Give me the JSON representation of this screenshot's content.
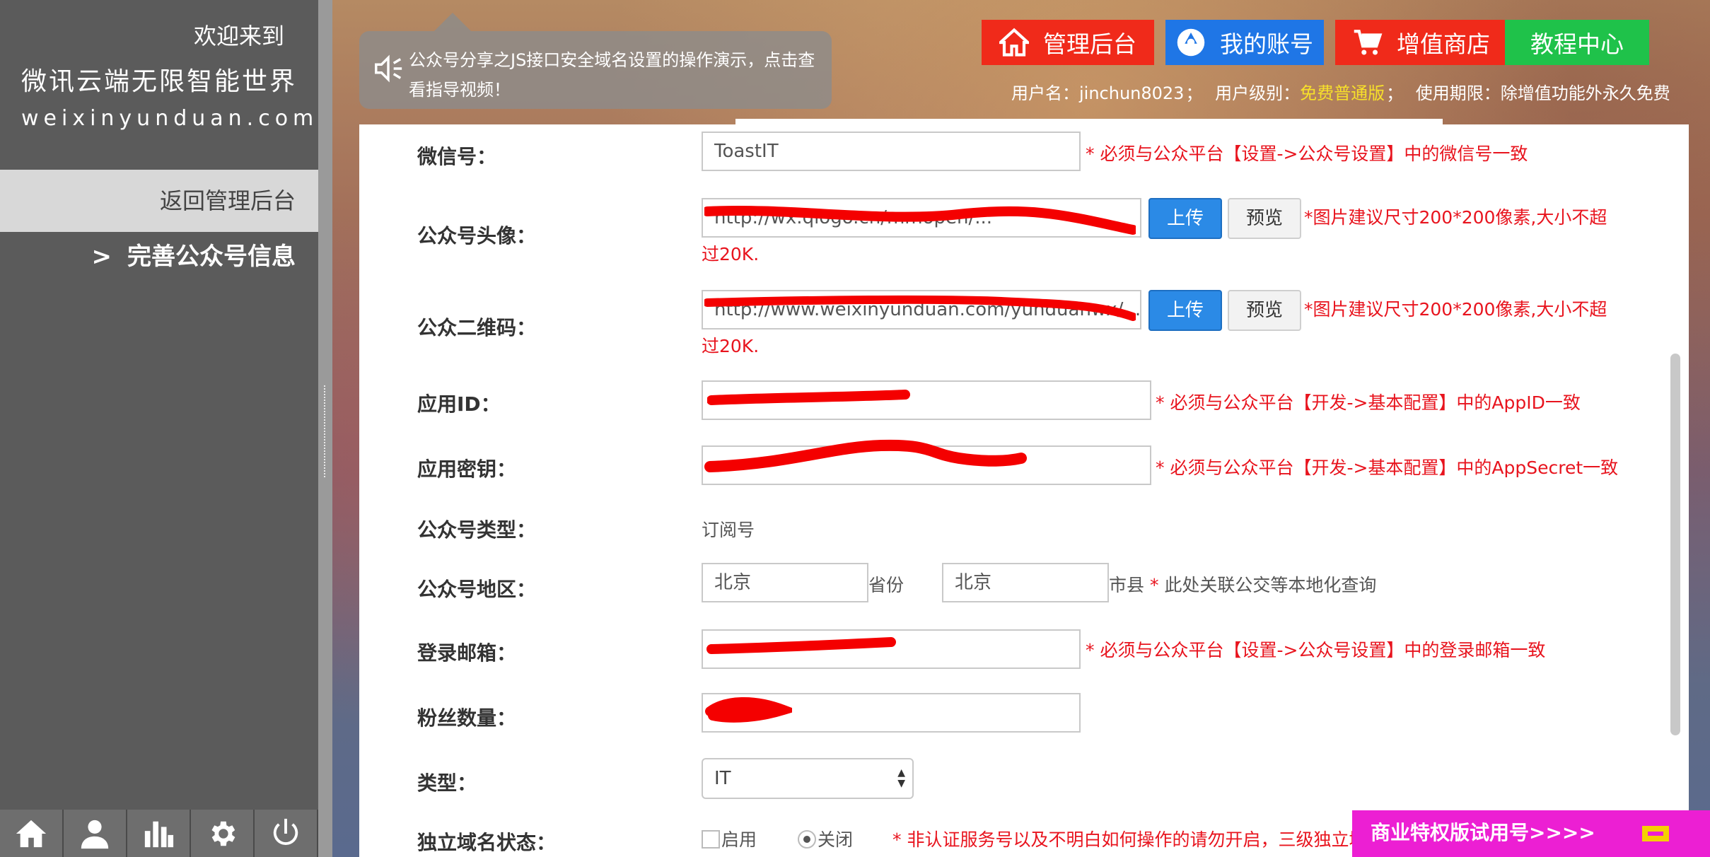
{
  "sidebar": {
    "welcome": "欢迎来到",
    "site_title": "微讯云端无限智能世界",
    "site_domain": "weixinyunduan.com",
    "back_link": "返回管理后台",
    "current_item_chevron": ">",
    "current_item": "完善公众号信息",
    "bottom_icons": [
      "home-icon",
      "user-icon",
      "bar-chart-icon",
      "gear-icon",
      "power-icon"
    ]
  },
  "announcement": {
    "icon": "speaker-icon",
    "text": "公众号分享之JS接口安全域名设置的操作演示，点击查看指导视频！"
  },
  "header": {
    "buttons": {
      "admin": "管理后台",
      "account": "我的账号",
      "shop": "增值商店",
      "tutorial": "教程中心"
    },
    "user_label": "用户名：",
    "username": "jinchun8023",
    "level_label": "用户级别：",
    "level": "免费普通版",
    "term_label": "使用期限：",
    "term": "除增值功能外永久免费",
    "sep": "；",
    "colors": {
      "red": "#f02a1a",
      "blue": "#1f76e6",
      "green": "#1fc24a",
      "level": "#f7e02a"
    }
  },
  "form": {
    "wechat_id": {
      "label": "微信号：",
      "value": "ToastIT",
      "note": "* 必须与公众平台【设置->公众号设置】中的微信号一致"
    },
    "avatar": {
      "label": "公众号头像：",
      "value": "http://wx.qlogo.cn/mmopen/...",
      "upload": "上传",
      "preview": "预览",
      "note": "*图片建议尺寸200*200像素,大小不超过20K."
    },
    "qrcode": {
      "label": "公众二维码：",
      "value": "http://www.weixinyunduan.com/yunduanwx/...",
      "upload": "上传",
      "preview": "预览",
      "note": "*图片建议尺寸200*200像素,大小不超过20K."
    },
    "app_id": {
      "label": "应用ID：",
      "value": "",
      "note": "* 必须与公众平台【开发->基本配置】中的AppID一致"
    },
    "app_secret": {
      "label": "应用密钥：",
      "value": "",
      "note": "* 必须与公众平台【开发->基本配置】中的AppSecret一致"
    },
    "account_type": {
      "label": "公众号类型：",
      "value": "订阅号"
    },
    "region": {
      "label": "公众号地区：",
      "province": "北京",
      "province_suffix": "省份",
      "city": "北京",
      "city_suffix": "市县",
      "note_star": "*",
      "note": "此处关联公交等本地化查询"
    },
    "email": {
      "label": "登录邮箱：",
      "value": "",
      "note": "* 必须与公众平台【设置->公众号设置】中的登录邮箱一致"
    },
    "fans": {
      "label": "粉丝数量：",
      "value": ""
    },
    "category": {
      "label": "类型：",
      "value": "IT"
    },
    "domain_status": {
      "label": "独立域名状态：",
      "on": "启用",
      "off": "关闭",
      "selected": "关闭",
      "note": "* 非认证服务号以及不明白如何操作的请勿开启，三级独立域名"
    }
  },
  "trial_banner": {
    "text": "商业特权版试用号>>>>"
  }
}
